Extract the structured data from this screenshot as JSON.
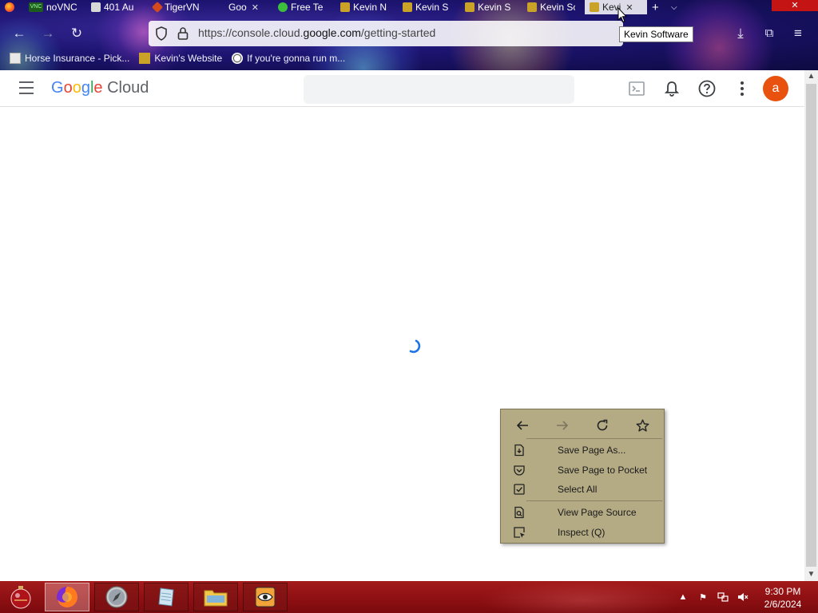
{
  "browser": {
    "tabs": [
      {
        "title": "",
        "favicon": "firefox-icon",
        "active": false
      },
      {
        "title": "noVNC",
        "favicon": "vnc-icon",
        "active": false
      },
      {
        "title": "401 Au",
        "favicon": "generic-site-icon",
        "active": false
      },
      {
        "title": "TigerVN",
        "favicon": "tigervnc-icon",
        "active": false
      },
      {
        "title": "Goo",
        "favicon": "google-icon",
        "active": false,
        "closable": true
      },
      {
        "title": "Free Te",
        "favicon": "green-circle-icon",
        "active": false
      },
      {
        "title": "Kevin N",
        "favicon": "kevin-site-icon",
        "active": false
      },
      {
        "title": "Kevin S",
        "favicon": "kevin-site-icon",
        "active": false
      },
      {
        "title": "Kevin S",
        "favicon": "kevin-site-icon",
        "active": false
      },
      {
        "title": "Kevin Sc",
        "favicon": "kevin-site-icon",
        "active": false
      },
      {
        "title": "Kevi",
        "favicon": "kevin-site-icon",
        "active": true,
        "closable": true
      }
    ],
    "url_prefix": "https://console.cloud.",
    "url_domain": "google.com",
    "url_path": "/getting-started",
    "tooltip": "Kevin Software",
    "bookmarks": [
      {
        "label": "Horse Insurance - Pick...",
        "icon": "page-icon"
      },
      {
        "label": "Kevin's Website",
        "icon": "kevin-site-icon"
      },
      {
        "label": "If you're gonna run m...",
        "icon": "soccer-ball-icon"
      }
    ]
  },
  "gc_header": {
    "logo_google": [
      "G",
      "o",
      "o",
      "g",
      "l",
      "e"
    ],
    "logo_cloud": "Cloud",
    "avatar_letter": "a"
  },
  "context_menu": {
    "items": [
      {
        "label": "Save Page As...",
        "icon": "save-page-icon"
      },
      {
        "label": "Save Page to Pocket",
        "icon": "pocket-icon"
      },
      {
        "label": "Select All",
        "icon": "select-all-icon"
      },
      {
        "label": "View Page Source",
        "icon": "view-source-icon"
      },
      {
        "label": "Inspect (Q)",
        "icon": "inspect-icon"
      }
    ]
  },
  "taskbar": {
    "time": "9:30 PM",
    "date": "2/6/2024"
  },
  "colors": {
    "avatar": "#e8520e",
    "context_menu_bg": "#b4ab85",
    "taskbar": "#8c0f12"
  }
}
